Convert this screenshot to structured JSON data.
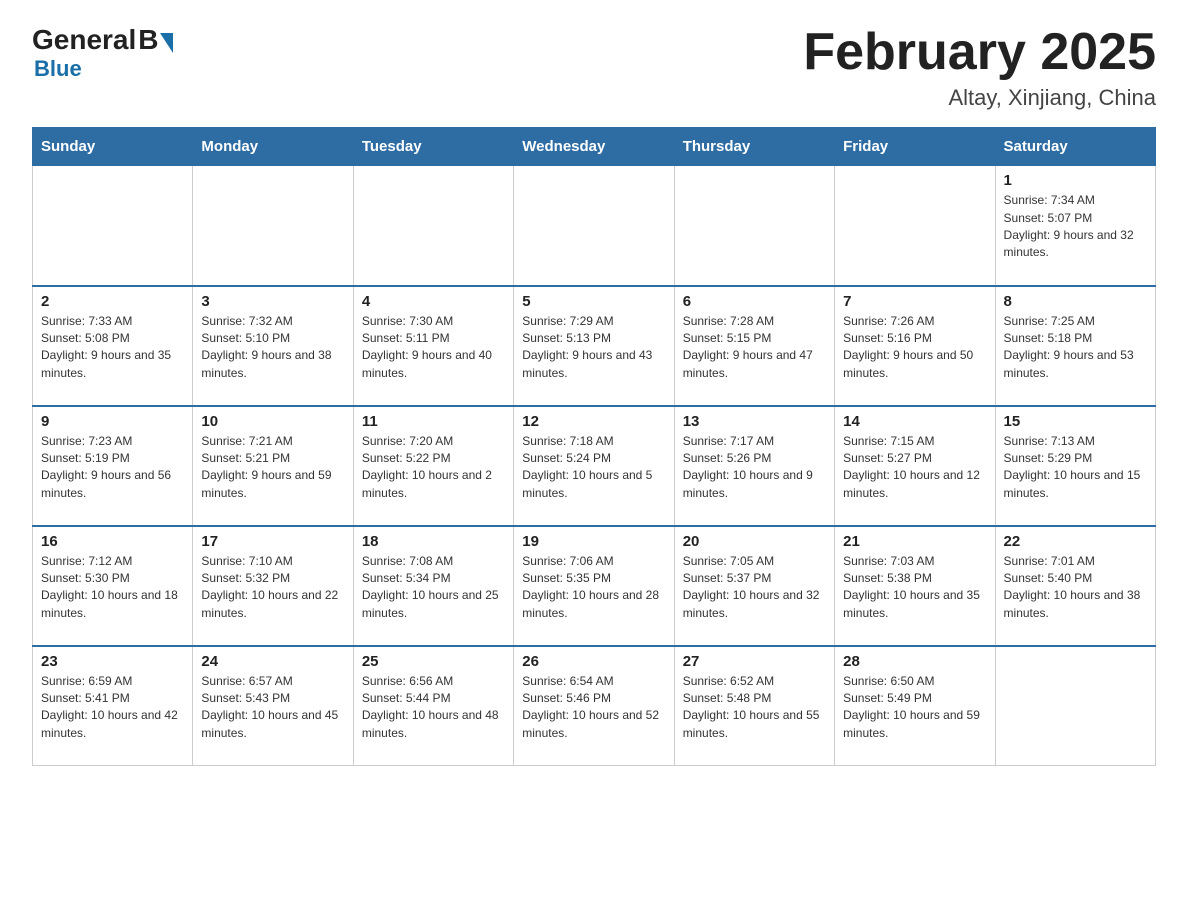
{
  "header": {
    "logo_general": "General",
    "logo_blue": "Blue",
    "title": "February 2025",
    "subtitle": "Altay, Xinjiang, China"
  },
  "days_of_week": [
    "Sunday",
    "Monday",
    "Tuesday",
    "Wednesday",
    "Thursday",
    "Friday",
    "Saturday"
  ],
  "weeks": [
    [
      {
        "day": "",
        "sunrise": "",
        "sunset": "",
        "daylight": ""
      },
      {
        "day": "",
        "sunrise": "",
        "sunset": "",
        "daylight": ""
      },
      {
        "day": "",
        "sunrise": "",
        "sunset": "",
        "daylight": ""
      },
      {
        "day": "",
        "sunrise": "",
        "sunset": "",
        "daylight": ""
      },
      {
        "day": "",
        "sunrise": "",
        "sunset": "",
        "daylight": ""
      },
      {
        "day": "",
        "sunrise": "",
        "sunset": "",
        "daylight": ""
      },
      {
        "day": "1",
        "sunrise": "Sunrise: 7:34 AM",
        "sunset": "Sunset: 5:07 PM",
        "daylight": "Daylight: 9 hours and 32 minutes."
      }
    ],
    [
      {
        "day": "2",
        "sunrise": "Sunrise: 7:33 AM",
        "sunset": "Sunset: 5:08 PM",
        "daylight": "Daylight: 9 hours and 35 minutes."
      },
      {
        "day": "3",
        "sunrise": "Sunrise: 7:32 AM",
        "sunset": "Sunset: 5:10 PM",
        "daylight": "Daylight: 9 hours and 38 minutes."
      },
      {
        "day": "4",
        "sunrise": "Sunrise: 7:30 AM",
        "sunset": "Sunset: 5:11 PM",
        "daylight": "Daylight: 9 hours and 40 minutes."
      },
      {
        "day": "5",
        "sunrise": "Sunrise: 7:29 AM",
        "sunset": "Sunset: 5:13 PM",
        "daylight": "Daylight: 9 hours and 43 minutes."
      },
      {
        "day": "6",
        "sunrise": "Sunrise: 7:28 AM",
        "sunset": "Sunset: 5:15 PM",
        "daylight": "Daylight: 9 hours and 47 minutes."
      },
      {
        "day": "7",
        "sunrise": "Sunrise: 7:26 AM",
        "sunset": "Sunset: 5:16 PM",
        "daylight": "Daylight: 9 hours and 50 minutes."
      },
      {
        "day": "8",
        "sunrise": "Sunrise: 7:25 AM",
        "sunset": "Sunset: 5:18 PM",
        "daylight": "Daylight: 9 hours and 53 minutes."
      }
    ],
    [
      {
        "day": "9",
        "sunrise": "Sunrise: 7:23 AM",
        "sunset": "Sunset: 5:19 PM",
        "daylight": "Daylight: 9 hours and 56 minutes."
      },
      {
        "day": "10",
        "sunrise": "Sunrise: 7:21 AM",
        "sunset": "Sunset: 5:21 PM",
        "daylight": "Daylight: 9 hours and 59 minutes."
      },
      {
        "day": "11",
        "sunrise": "Sunrise: 7:20 AM",
        "sunset": "Sunset: 5:22 PM",
        "daylight": "Daylight: 10 hours and 2 minutes."
      },
      {
        "day": "12",
        "sunrise": "Sunrise: 7:18 AM",
        "sunset": "Sunset: 5:24 PM",
        "daylight": "Daylight: 10 hours and 5 minutes."
      },
      {
        "day": "13",
        "sunrise": "Sunrise: 7:17 AM",
        "sunset": "Sunset: 5:26 PM",
        "daylight": "Daylight: 10 hours and 9 minutes."
      },
      {
        "day": "14",
        "sunrise": "Sunrise: 7:15 AM",
        "sunset": "Sunset: 5:27 PM",
        "daylight": "Daylight: 10 hours and 12 minutes."
      },
      {
        "day": "15",
        "sunrise": "Sunrise: 7:13 AM",
        "sunset": "Sunset: 5:29 PM",
        "daylight": "Daylight: 10 hours and 15 minutes."
      }
    ],
    [
      {
        "day": "16",
        "sunrise": "Sunrise: 7:12 AM",
        "sunset": "Sunset: 5:30 PM",
        "daylight": "Daylight: 10 hours and 18 minutes."
      },
      {
        "day": "17",
        "sunrise": "Sunrise: 7:10 AM",
        "sunset": "Sunset: 5:32 PM",
        "daylight": "Daylight: 10 hours and 22 minutes."
      },
      {
        "day": "18",
        "sunrise": "Sunrise: 7:08 AM",
        "sunset": "Sunset: 5:34 PM",
        "daylight": "Daylight: 10 hours and 25 minutes."
      },
      {
        "day": "19",
        "sunrise": "Sunrise: 7:06 AM",
        "sunset": "Sunset: 5:35 PM",
        "daylight": "Daylight: 10 hours and 28 minutes."
      },
      {
        "day": "20",
        "sunrise": "Sunrise: 7:05 AM",
        "sunset": "Sunset: 5:37 PM",
        "daylight": "Daylight: 10 hours and 32 minutes."
      },
      {
        "day": "21",
        "sunrise": "Sunrise: 7:03 AM",
        "sunset": "Sunset: 5:38 PM",
        "daylight": "Daylight: 10 hours and 35 minutes."
      },
      {
        "day": "22",
        "sunrise": "Sunrise: 7:01 AM",
        "sunset": "Sunset: 5:40 PM",
        "daylight": "Daylight: 10 hours and 38 minutes."
      }
    ],
    [
      {
        "day": "23",
        "sunrise": "Sunrise: 6:59 AM",
        "sunset": "Sunset: 5:41 PM",
        "daylight": "Daylight: 10 hours and 42 minutes."
      },
      {
        "day": "24",
        "sunrise": "Sunrise: 6:57 AM",
        "sunset": "Sunset: 5:43 PM",
        "daylight": "Daylight: 10 hours and 45 minutes."
      },
      {
        "day": "25",
        "sunrise": "Sunrise: 6:56 AM",
        "sunset": "Sunset: 5:44 PM",
        "daylight": "Daylight: 10 hours and 48 minutes."
      },
      {
        "day": "26",
        "sunrise": "Sunrise: 6:54 AM",
        "sunset": "Sunset: 5:46 PM",
        "daylight": "Daylight: 10 hours and 52 minutes."
      },
      {
        "day": "27",
        "sunrise": "Sunrise: 6:52 AM",
        "sunset": "Sunset: 5:48 PM",
        "daylight": "Daylight: 10 hours and 55 minutes."
      },
      {
        "day": "28",
        "sunrise": "Sunrise: 6:50 AM",
        "sunset": "Sunset: 5:49 PM",
        "daylight": "Daylight: 10 hours and 59 minutes."
      },
      {
        "day": "",
        "sunrise": "",
        "sunset": "",
        "daylight": ""
      }
    ]
  ]
}
